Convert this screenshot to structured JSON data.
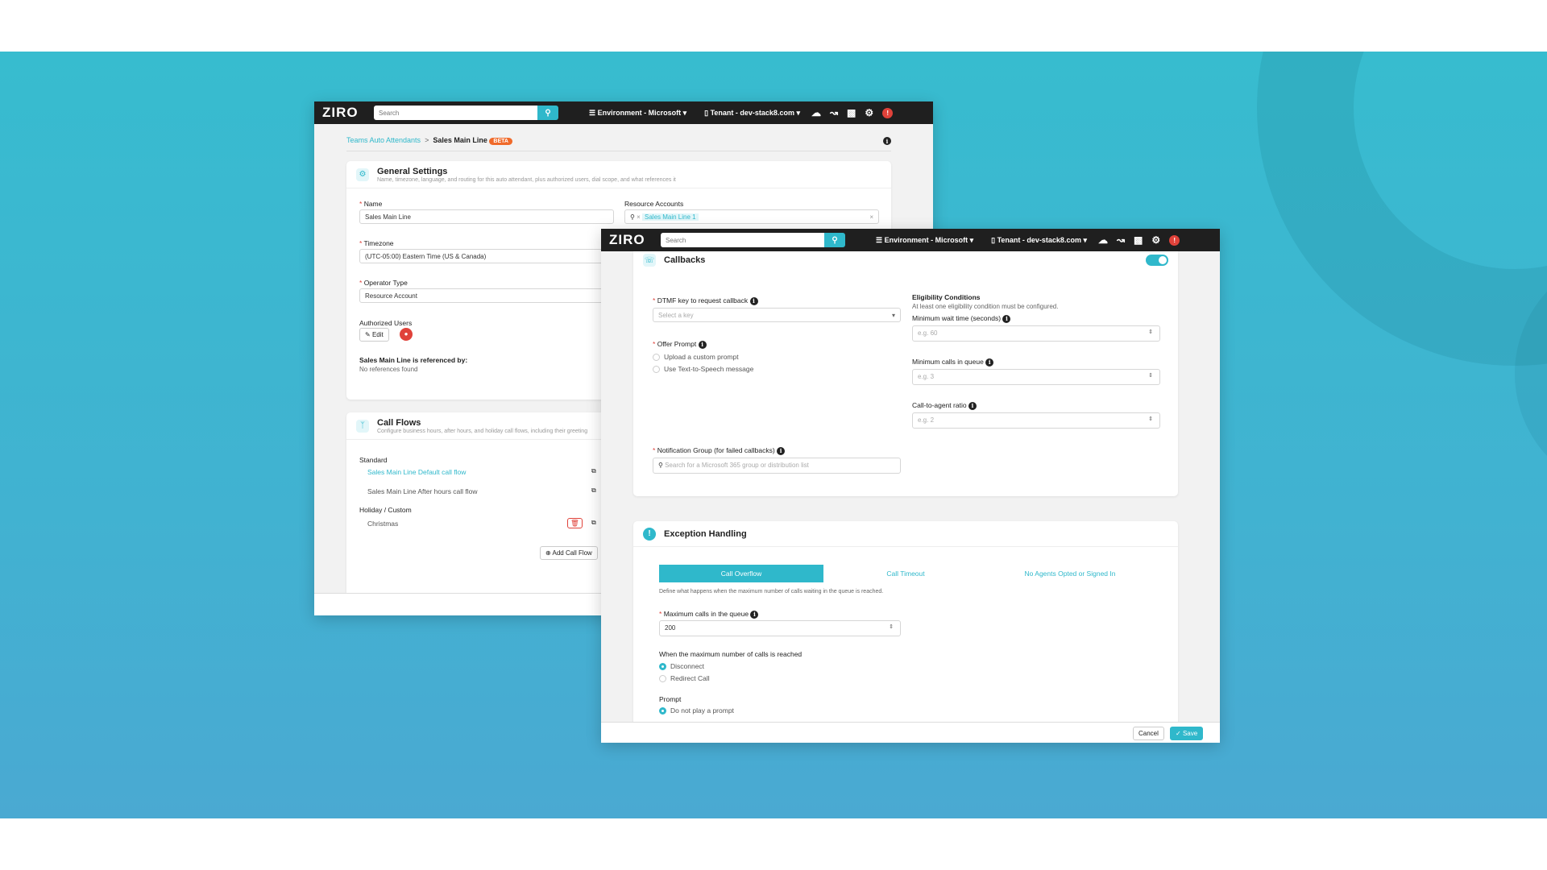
{
  "brand": "ZIRO",
  "nav": {
    "search_placeholder": "Search",
    "environment": "Environment - Microsoft",
    "tenant": "Tenant - dev-stack8.com"
  },
  "win1": {
    "breadcrumb": {
      "parent": "Teams Auto Attendants",
      "separator": ">",
      "current": "Sales Main Line",
      "badge": "BETA"
    },
    "general": {
      "title": "General Settings",
      "subtitle": "Name, timezone, language, and routing for this auto attendant, plus authorized users, dial scope, and what references it",
      "name_label": "Name",
      "name_value": "Sales Main Line",
      "resource_label": "Resource Accounts",
      "resource_chip": "Sales Main Line 1",
      "timezone_label": "Timezone",
      "timezone_value": "(UTC-05:00) Eastern Time (US & Canada)",
      "operator_label": "Operator Type",
      "operator_value": "Resource Account",
      "users_label": "Authorized Users",
      "edit_label": "Edit",
      "ref_label": "Sales Main Line is referenced by:",
      "ref_value": "No references found"
    },
    "callflows": {
      "title": "Call Flows",
      "subtitle": "Configure business hours, after hours, and holiday call flows, including their greeting",
      "standard_label": "Standard",
      "flow1": "Sales Main Line Default call flow",
      "flow2": "Sales Main Line After hours call flow",
      "holiday_label": "Holiday / Custom",
      "holiday1": "Christmas",
      "add_label": "Add Call Flow"
    }
  },
  "win2": {
    "callbacks": {
      "title": "Callbacks",
      "dtmf_label": "DTMF key to request callback",
      "dtmf_placeholder": "Select a key",
      "offer_label": "Offer Prompt",
      "offer_opt1": "Upload a custom prompt",
      "offer_opt2": "Use Text-to-Speech message",
      "notify_label": "Notification Group (for failed callbacks)",
      "notify_placeholder": "Search for a Microsoft 365 group or distribution list",
      "elig_title": "Eligibility Conditions",
      "elig_sub": "At least one eligibility condition must be configured.",
      "wait_label": "Minimum wait time (seconds)",
      "wait_placeholder": "e.g. 60",
      "calls_label": "Minimum calls in queue",
      "calls_placeholder": "e.g. 3",
      "ratio_label": "Call-to-agent ratio",
      "ratio_placeholder": "e.g. 2"
    },
    "exception": {
      "title": "Exception Handling",
      "tabs": [
        "Call Overflow",
        "Call Timeout",
        "No Agents Opted or Signed In"
      ],
      "desc": "Define what happens when the maximum number of calls waiting in the queue is reached.",
      "max_label": "Maximum calls in the queue",
      "max_value": "200",
      "when_label": "When the maximum number of calls is reached",
      "when_opt1": "Disconnect",
      "when_opt2": "Redirect Call",
      "prompt_label": "Prompt",
      "prompt_opt1": "Do not play a prompt"
    },
    "cancel": "Cancel",
    "save": "Save"
  }
}
